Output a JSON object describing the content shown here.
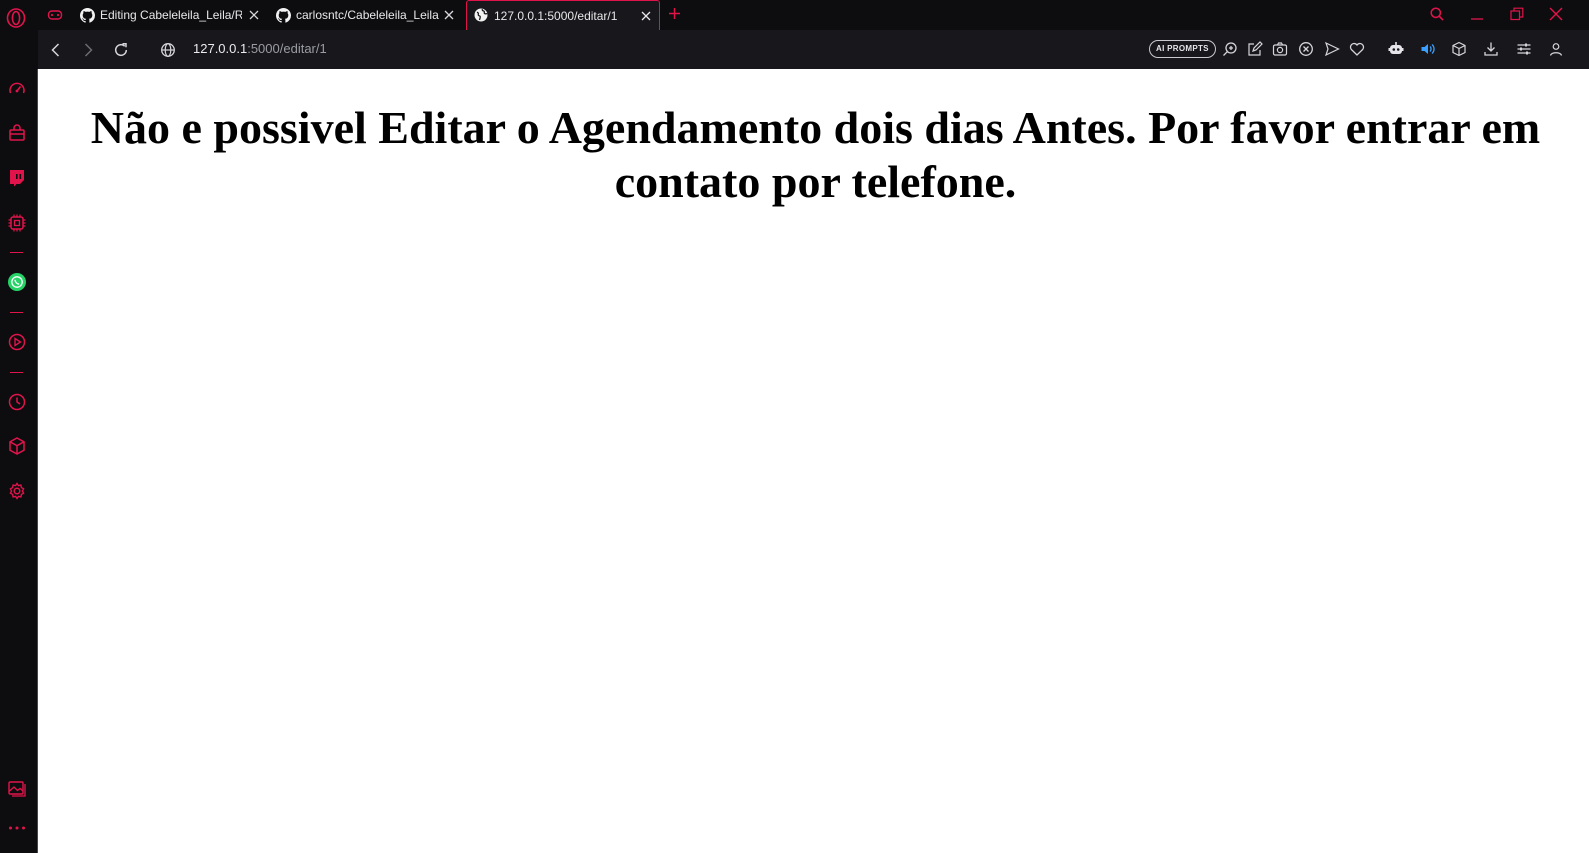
{
  "browser": {
    "tabs": [
      {
        "title": "Editing Cabeleleila_Leila/README.md",
        "icon": "github-icon",
        "active": false
      },
      {
        "title": "carlosntc/Cabeleleila_Leila",
        "icon": "github-icon",
        "active": false
      },
      {
        "title": "127.0.0.1:5000/editar/1",
        "icon": "globe-icon",
        "active": true
      }
    ],
    "address_bar": {
      "host": "127.0.0.1",
      "path": ":5000/editar/1"
    },
    "toolbar": {
      "ai_prompts_label": "AI PROMPTS"
    },
    "accent_color": "#e0144a",
    "sidebar_icons": [
      "speed-dial-icon",
      "shopping-bag-icon",
      "twitch-icon",
      "aria-icon",
      "whatsapp-icon",
      "player-icon",
      "history-icon",
      "extensions-icon",
      "settings-icon",
      "gallery-icon",
      "more-icon"
    ]
  },
  "page": {
    "heading": "Não e possivel Editar o Agendamento dois dias Antes. Por favor entrar em contato por telefone."
  }
}
